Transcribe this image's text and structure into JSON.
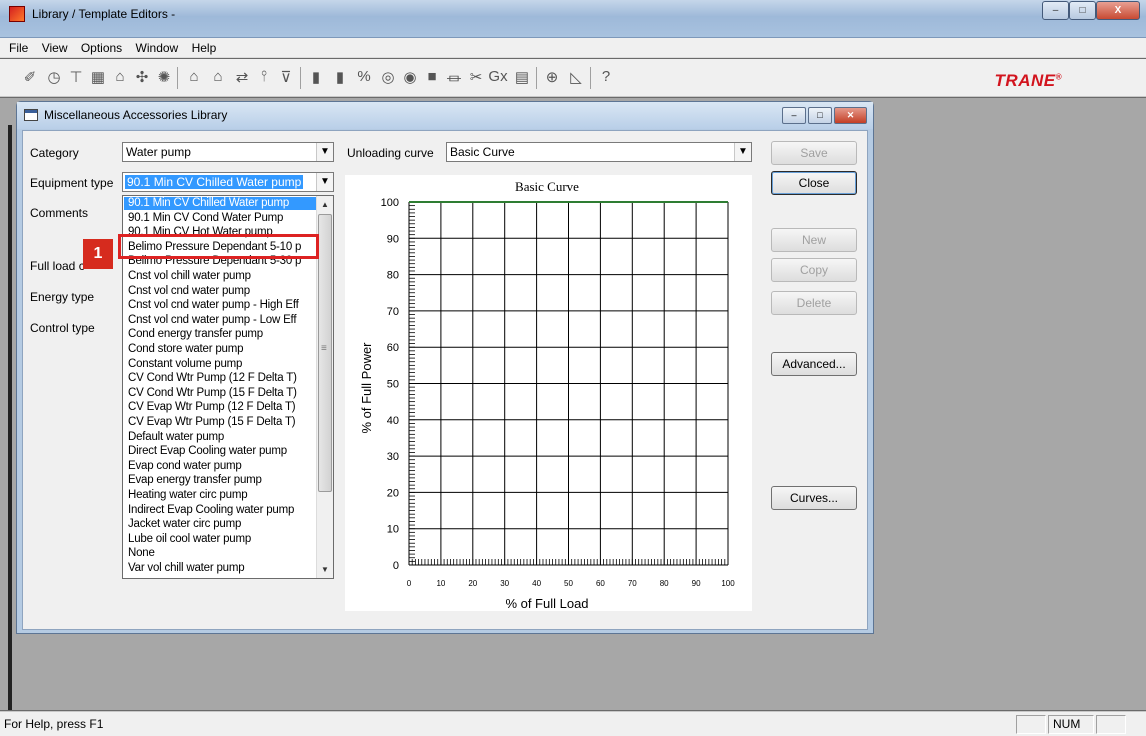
{
  "window": {
    "title": "Library / Template Editors -",
    "controls": [
      "–",
      "□",
      "X"
    ]
  },
  "menu": [
    "File",
    "View",
    "Options",
    "Window",
    "Help"
  ],
  "toolbar": {
    "brand": "TRANE",
    "brand_mark": "®"
  },
  "child": {
    "title": "Miscellaneous Accessories Library",
    "controls": [
      "–",
      "□",
      "✕"
    ]
  },
  "form": {
    "category_label": "Category",
    "category_value": "Water pump",
    "equipment_type_label": "Equipment type",
    "equipment_type_value": "90.1 Min CV Chilled Water pump",
    "comments_label": "Comments",
    "full_load_label": "Full load c",
    "energy_type_label": "Energy type",
    "control_type_label": "Control type",
    "unloading_curve_label": "Unloading curve",
    "unloading_curve_value": "Basic Curve"
  },
  "dropdown_items": [
    "90.1 Min CV Chilled Water pump",
    "90.1 Min CV Cond Water Pump",
    "90.1 Min CV Hot Water pump",
    "Belimo Pressure Dependant 5-10 p",
    "Belimo Pressure Dependant 5-30 p",
    "Cnst vol chill water pump",
    "Cnst vol cnd water pump",
    "Cnst vol cnd water pump - High Eff",
    "Cnst vol cnd water pump - Low Eff",
    "Cond energy transfer pump",
    "Cond store water pump",
    "Constant volume pump",
    "CV Cond Wtr Pump (12 F Delta T)",
    "CV Cond Wtr Pump (15 F Delta T)",
    "CV Evap Wtr Pump (12 F Delta T)",
    "CV Evap Wtr Pump (15 F Delta T)",
    "Default water pump",
    "Direct Evap Cooling water pump",
    "Evap cond water pump",
    "Evap energy transfer pump",
    "Heating water circ pump",
    "Indirect Evap Cooling water pump",
    "Jacket water circ pump",
    "Lube oil cool water pump",
    "None",
    "Var vol chill water pump"
  ],
  "callout": {
    "number": "1"
  },
  "buttons": {
    "save": "Save",
    "close": "Close",
    "new": "New",
    "copy": "Copy",
    "delete": "Delete",
    "advanced": "Advanced...",
    "curves": "Curves..."
  },
  "chart_data": {
    "type": "line",
    "title": "Basic Curve",
    "xlabel": "% of Full Load",
    "ylabel": "% of Full Power",
    "xlim": [
      0,
      100
    ],
    "ylim": [
      0,
      100
    ],
    "x_ticks": [
      "0",
      "10",
      "20",
      "30",
      "40",
      "50",
      "60",
      "70",
      "80",
      "90",
      "100"
    ],
    "y_ticks": [
      "0",
      "10",
      "20",
      "30",
      "40",
      "50",
      "60",
      "70",
      "80",
      "90",
      "100"
    ],
    "grid": true,
    "series": [
      {
        "x": [
          0,
          100
        ],
        "y": [
          100,
          100
        ],
        "color": "#2e7d32"
      }
    ]
  },
  "statusbar": {
    "help": "For Help, press F1",
    "num": "NUM"
  }
}
